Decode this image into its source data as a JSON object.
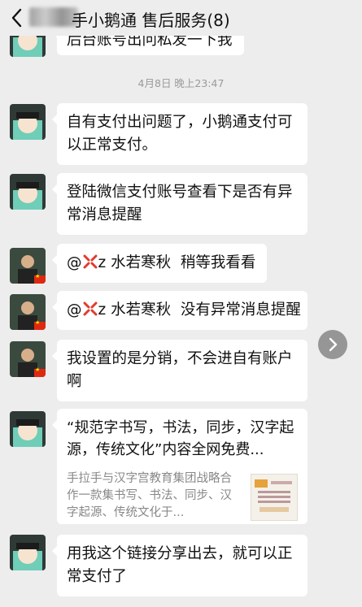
{
  "header": {
    "title": "手小鹅通 售后服务(8)"
  },
  "messages": {
    "partial_top": "后台账号出问私发一下我",
    "timestamp": "4月8日 晚上23:47",
    "m1": "自有支付出问题了，小鹅通支付可以正常支付。",
    "m2": "登陆微信支付账号查看下是否有异常消息提醒",
    "m3_mention": "z 水若寒秋",
    "m3_text": "稍等我看看",
    "m4_mention": "z 水若寒秋",
    "m4_text": "没有异常消息提醒",
    "m5": "我设置的是分销，不会进自有账户啊",
    "card": {
      "title": "“规范字书写，书法，同步，汉字起源，传统文化”内容全网免费...",
      "desc": "手拉手与汉字宫教育集团战略合作一款集书写、书法、同步、汉字起源、传统文化于..."
    },
    "m7": "用我这个链接分享出去，就可以正常支付了"
  },
  "colors": {
    "background": "#ededed",
    "bubble": "#ffffff",
    "flag": "#de2910"
  }
}
